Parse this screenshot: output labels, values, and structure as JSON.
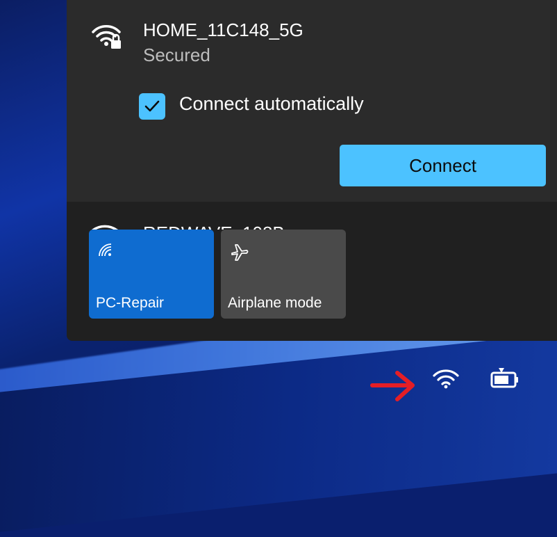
{
  "network": {
    "ssid": "HOME_11C148_5G",
    "security": "Secured",
    "auto_connect_label": "Connect automatically",
    "auto_connect_checked": true,
    "connect_label": "Connect"
  },
  "next_network": {
    "ssid": "REDWAVE_108B"
  },
  "quick_settings": {
    "tiles": [
      {
        "label": "PC-Repair",
        "icon": "wifi-icon",
        "active": true
      },
      {
        "label": "Airplane mode",
        "icon": "airplane-icon",
        "active": false
      }
    ]
  },
  "taskbar": {
    "icons": [
      "red-arrow-icon",
      "wifi-icon",
      "battery-icon"
    ]
  },
  "colors": {
    "accent": "#4cc2ff",
    "active_tile": "#0f6cd0",
    "inactive_tile": "#4a4a4a",
    "panel": "#202020",
    "card": "#2b2b2b",
    "annotation_arrow": "#e41e26"
  }
}
